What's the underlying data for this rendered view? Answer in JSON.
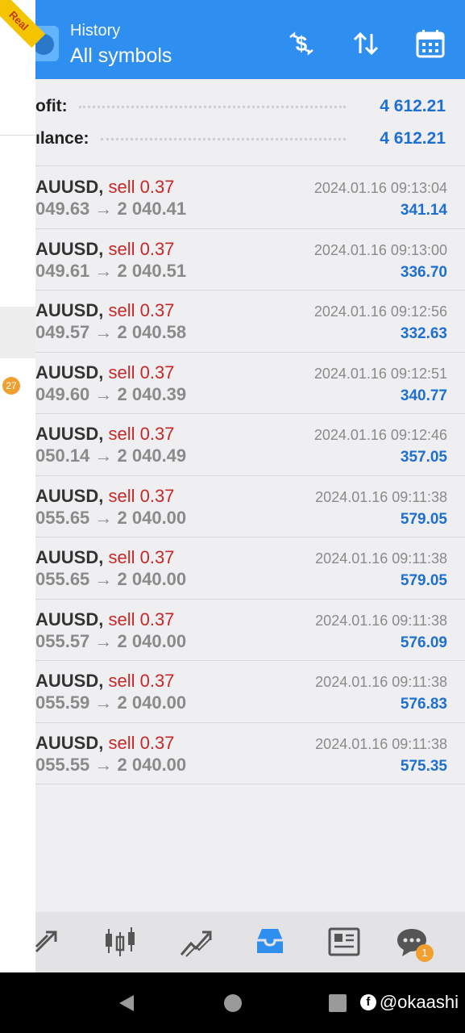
{
  "header": {
    "subtitle": "History",
    "title": "All symbols",
    "account_ribbon": "Real",
    "icons": [
      "currency-icon",
      "sort-icon",
      "calendar-icon"
    ]
  },
  "drawer": {
    "badge": "27"
  },
  "summary": {
    "profit_label": "ofit:",
    "profit_value": "4 612.21",
    "balance_label": "ılance:",
    "balance_value": "4 612.21"
  },
  "trades": [
    {
      "symbol": "AUUSD,",
      "side": "sell 0.37",
      "prices": "049.63 → 2 040.41",
      "time": "2024.01.16 09:13:04",
      "profit": "341.14"
    },
    {
      "symbol": "AUUSD,",
      "side": "sell 0.37",
      "prices": "049.61 → 2 040.51",
      "time": "2024.01.16 09:13:00",
      "profit": "336.70"
    },
    {
      "symbol": "AUUSD,",
      "side": "sell 0.37",
      "prices": "049.57 → 2 040.58",
      "time": "2024.01.16 09:12:56",
      "profit": "332.63"
    },
    {
      "symbol": "AUUSD,",
      "side": "sell 0.37",
      "prices": "049.60 → 2 040.39",
      "time": "2024.01.16 09:12:51",
      "profit": "340.77"
    },
    {
      "symbol": "AUUSD,",
      "side": "sell 0.37",
      "prices": "050.14 → 2 040.49",
      "time": "2024.01.16 09:12:46",
      "profit": "357.05"
    },
    {
      "symbol": "AUUSD,",
      "side": "sell 0.37",
      "prices": "055.65 → 2 040.00",
      "time": "2024.01.16 09:11:38",
      "profit": "579.05"
    },
    {
      "symbol": "AUUSD,",
      "side": "sell 0.37",
      "prices": "055.65 → 2 040.00",
      "time": "2024.01.16 09:11:38",
      "profit": "579.05"
    },
    {
      "symbol": "AUUSD,",
      "side": "sell 0.37",
      "prices": "055.57 → 2 040.00",
      "time": "2024.01.16 09:11:38",
      "profit": "576.09"
    },
    {
      "symbol": "AUUSD,",
      "side": "sell 0.37",
      "prices": "055.59 → 2 040.00",
      "time": "2024.01.16 09:11:38",
      "profit": "576.83"
    },
    {
      "symbol": "AUUSD,",
      "side": "sell 0.37",
      "prices": "055.55 → 2 040.00",
      "time": "2024.01.16 09:11:38",
      "profit": "575.35"
    }
  ],
  "bottom_nav": {
    "items": [
      "quotes-icon",
      "chart-icon",
      "trade-icon",
      "history-icon",
      "news-icon",
      "chat-icon"
    ],
    "active": "history-icon",
    "chat_badge": "1"
  },
  "system_bar": {
    "watermark": "@okaashi",
    "icons": [
      "back-icon",
      "home-icon",
      "recents-icon",
      "facebook-icon"
    ]
  },
  "colors": {
    "header_bg": "#2f8ff0",
    "profit_blue": "#1e6fd0",
    "sell_red": "#c62828",
    "badge_orange": "#f0a030"
  }
}
